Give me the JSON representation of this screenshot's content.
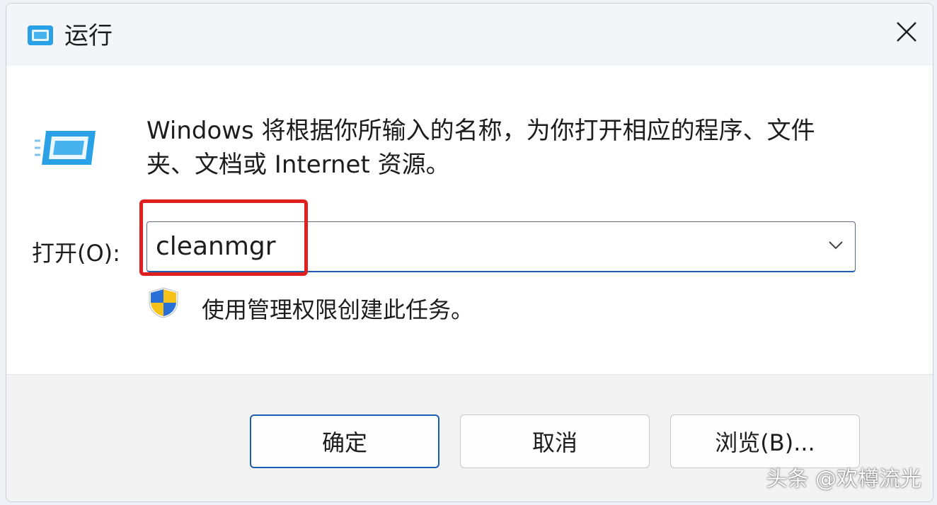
{
  "window": {
    "title": "运行"
  },
  "content": {
    "description": "Windows 将根据你所输入的名称，为你打开相应的程序、文件夹、文档或 Internet 资源。",
    "open_label": "打开(O):",
    "combo": {
      "value": "cleanmgr"
    },
    "admin_text": "使用管理权限创建此任务。"
  },
  "buttons": {
    "ok": "确定",
    "cancel": "取消",
    "browse": "浏览(B)..."
  },
  "watermark": "头条 @欢樽流光",
  "colors": {
    "accent": "#1a5fb4",
    "highlight": "#e01f1f",
    "footer_bg": "#f3f3f3"
  },
  "icons": {
    "title": "run-icon",
    "content": "run-icon",
    "close": "close-icon",
    "dropdown": "chevron-down-icon",
    "admin": "shield-icon"
  }
}
